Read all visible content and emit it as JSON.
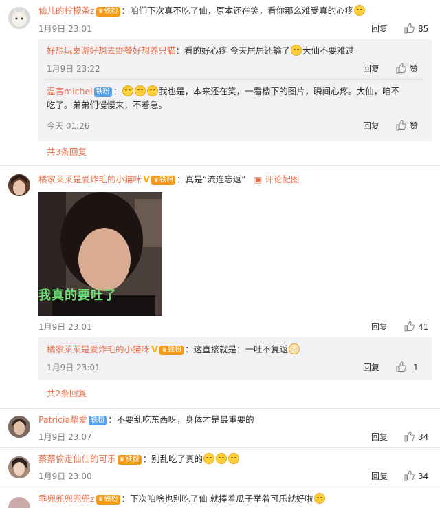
{
  "comments": [
    {
      "user": "仙儿的柠檬茶z",
      "badge": "铁粉",
      "text": "：咱们下次真不吃了仙，原本还在笑，看你那么难受真的心疼",
      "time": "1月9日 23:01",
      "reply_label": "回复",
      "likes": "85",
      "replies": [
        {
          "user": "好想玩桌游好想去野餐好想养只猫",
          "text": "：看的好心疼 今天居居还输了",
          "text2": "大仙不要难过",
          "time": "1月9日 23:22",
          "reply_label": "回复",
          "likes": "赞"
        },
        {
          "user": "温言michel",
          "badge": "铁粉",
          "text": "：",
          "text_a": "我也是，本来还在笑，一看楼下的图片，瞬间心疼。大仙，咱不",
          "text_b": "吃了。弟弟们慢慢来，不着急。",
          "time": "今天 01:26",
          "reply_label": "回复",
          "likes": "赞"
        }
      ],
      "more": "共3条回复"
    },
    {
      "user": "橘家莱莱是爱炸毛的小猫咪",
      "badge": "铁粉",
      "text": "：真是“流连忘返”",
      "pic_label": "评论配图",
      "image_caption": "我真的要吐了",
      "time": "1月9日 23:01",
      "reply_label": "回复",
      "likes": "41",
      "replies": [
        {
          "user": "橘家莱莱是爱炸毛的小猫咪",
          "badge": "铁粉",
          "text": "：这直接就是：一吐不复返",
          "time": "1月9日 23:01",
          "reply_label": "回复",
          "likes": "1"
        }
      ],
      "more": "共2条回复"
    },
    {
      "user": "Patricia挚爱",
      "badge": "铁粉",
      "text": "：不要乱吃东西呀，身体才是最重要的",
      "time": "1月9日 23:07",
      "reply_label": "回复",
      "likes": "34"
    },
    {
      "user": "蔡蔡偷走仙仙的可乐",
      "badge": "铁粉",
      "text": "：别乱吃了真的",
      "time": "1月9日 23:00",
      "reply_label": "回复",
      "likes": "34"
    },
    {
      "user": "乖兜兜兜兜兜z",
      "badge": "铁粉",
      "text": "：下次咱啥也别吃了仙 就捧着瓜子举着可乐就好啦"
    }
  ],
  "colors": {
    "username": "#eb7350",
    "reply_bg": "#f2f2f5",
    "iron_badge": "#f39b18",
    "fan_badge": "#5aa3e6"
  }
}
